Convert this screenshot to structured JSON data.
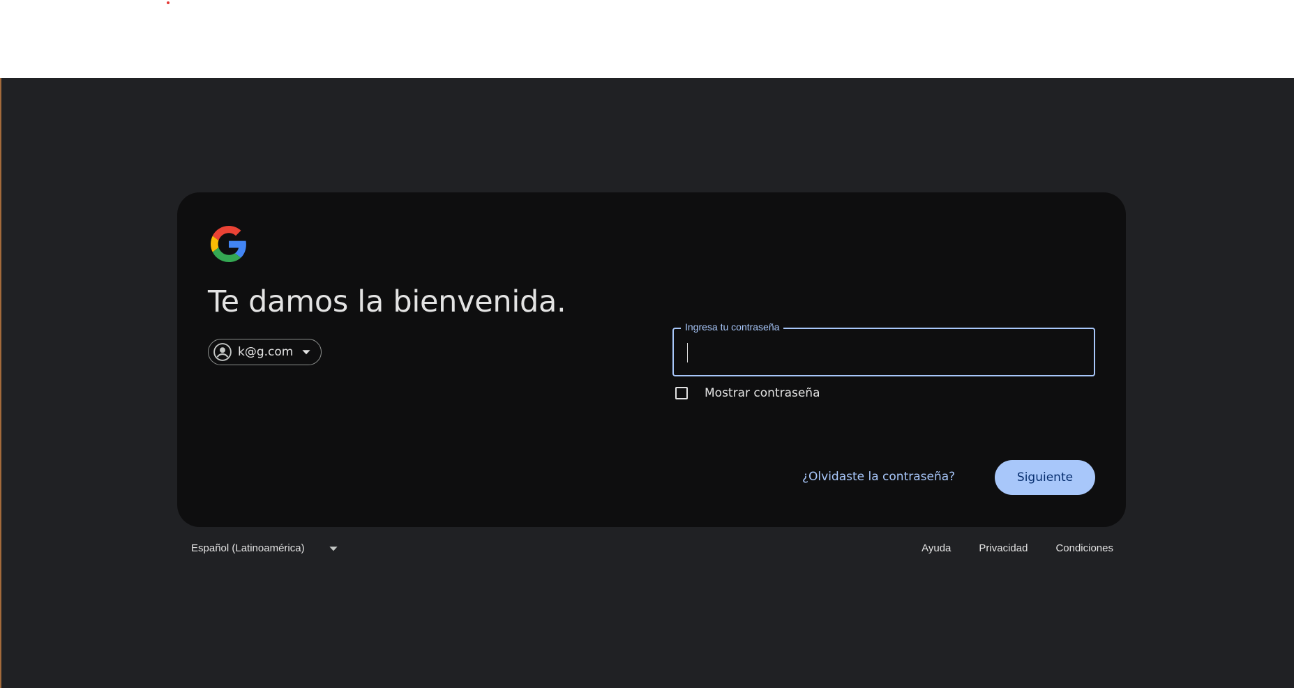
{
  "page": {
    "colors": {
      "background": "#202124",
      "card": "#0e0e0f",
      "accent": "#a8c7fa",
      "text": "#e3e3e3"
    }
  },
  "card": {
    "logo": "google-g-icon",
    "title": "Te damos la bienvenida.",
    "account": {
      "email": "k@g.com",
      "icon": "account-circle-icon",
      "dropdown_icon": "caret-down-icon"
    },
    "password": {
      "label": "Ingresa tu contraseña",
      "value": ""
    },
    "show_password": {
      "label": "Mostrar contraseña",
      "checked": false
    },
    "forgot_link": "¿Olvidaste la contraseña?",
    "next_button": "Siguiente"
  },
  "footer": {
    "language": "Español (Latinoamérica)",
    "links": [
      "Ayuda",
      "Privacidad",
      "Condiciones"
    ]
  }
}
